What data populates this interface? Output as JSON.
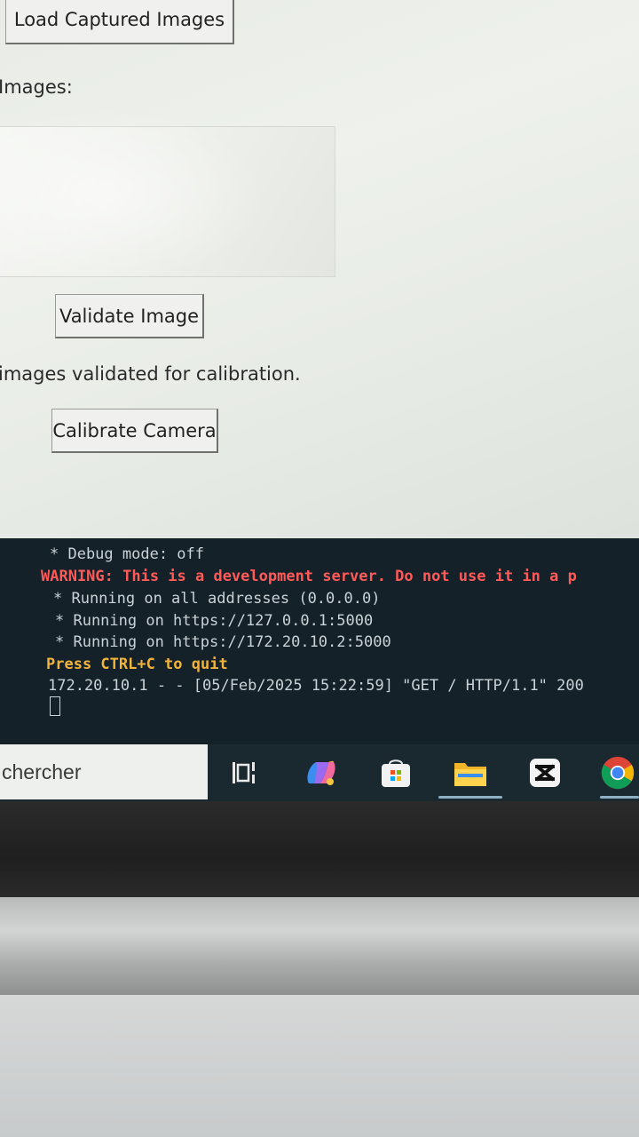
{
  "app": {
    "load_button": "Load Captured Images",
    "images_label": "Images:",
    "validate_button": "Validate Image",
    "status_text": "images validated for calibration.",
    "calibrate_button": "Calibrate Camera"
  },
  "terminal": {
    "lines": [
      "* Debug mode: off",
      "WARNING: This is a development server. Do not use it in a p",
      "* Running on all addresses (0.0.0.0)",
      "* Running on https://127.0.0.1:5000",
      "* Running on https://172.20.10.2:5000",
      "Press CTRL+C to quit",
      "172.20.10.1 - - [05/Feb/2025 15:22:59] \"GET / HTTP/1.1\" 200"
    ],
    "colors": {
      "background": "#142129",
      "warning": "#ff5a5a",
      "quit": "#f0b43c",
      "text": "#c9d2d6"
    }
  },
  "taskbar": {
    "search_text": "chercher",
    "icons": [
      "task-view-icon",
      "copilot-icon",
      "store-icon",
      "file-explorer-icon",
      "capcut-icon",
      "chrome-icon"
    ]
  }
}
